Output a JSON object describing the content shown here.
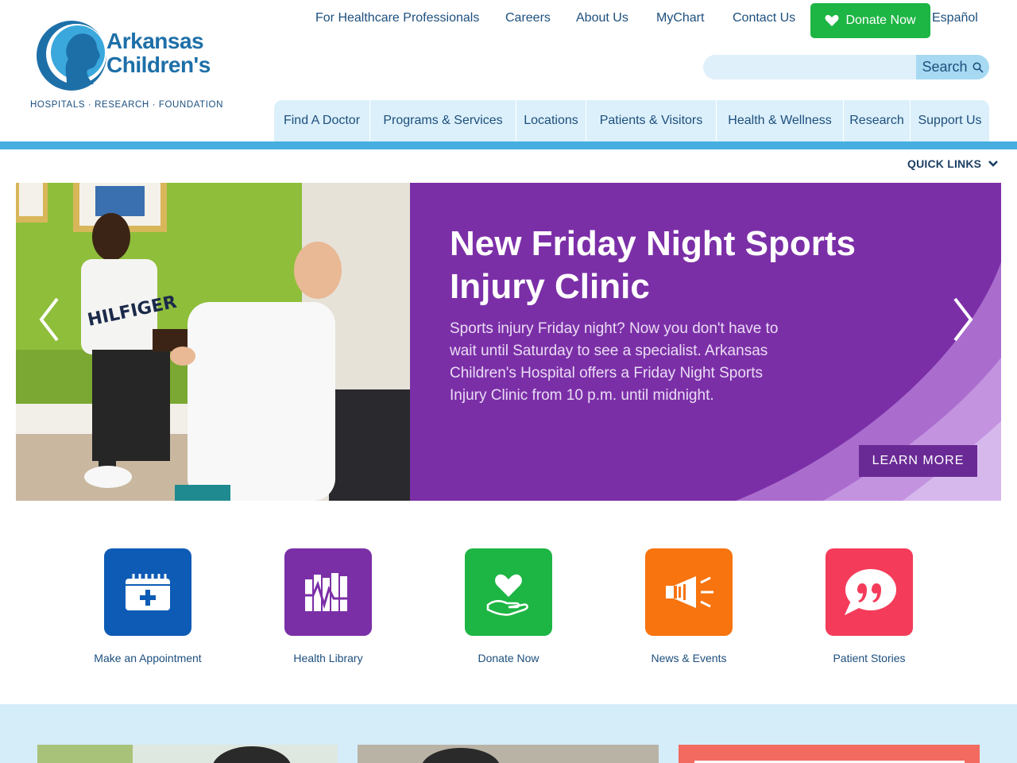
{
  "logo": {
    "line1": "Arkansas",
    "line2": "Children's",
    "tagline": "HOSPITALS · RESEARCH · FOUNDATION"
  },
  "utility_nav": [
    {
      "label": "For Healthcare Professionals"
    },
    {
      "label": "Careers"
    },
    {
      "label": "About Us"
    },
    {
      "label": "MyChart"
    },
    {
      "label": "Contact Us"
    },
    {
      "label": "Español"
    }
  ],
  "donate": {
    "label": "Donate Now"
  },
  "search": {
    "placeholder": "",
    "button_label": "Search"
  },
  "main_nav": [
    {
      "label": "Find A Doctor"
    },
    {
      "label": "Programs & Services"
    },
    {
      "label": "Locations"
    },
    {
      "label": "Patients & Visitors"
    },
    {
      "label": "Health & Wellness"
    },
    {
      "label": "Research"
    },
    {
      "label": "Support Us"
    }
  ],
  "quick_links": {
    "label": "QUICK LINKS"
  },
  "hero": {
    "title": "New Friday Night Sports Injury Clinic",
    "body": "Sports injury Friday night? Now you don't have to wait until Saturday to see a specialist. Arkansas Children's Hospital offers a Friday Night Sports Injury Clinic from 10 p.m. until midnight.",
    "cta": "LEARN MORE",
    "shirt_text": "HILFIGER"
  },
  "tiles": [
    {
      "label": "Make an Appointment",
      "icon": "calendar-plus-icon",
      "color": "#0d5bb5"
    },
    {
      "label": "Health Library",
      "icon": "books-icon",
      "color": "#7b2fa7"
    },
    {
      "label": "Donate Now",
      "icon": "heart-hand-icon",
      "color": "#1db544"
    },
    {
      "label": "News & Events",
      "icon": "megaphone-icon",
      "color": "#f7740f"
    },
    {
      "label": "Patient Stories",
      "icon": "quote-bubble-icon",
      "color": "#f43c5a"
    }
  ],
  "colors": {
    "brand_blue": "#1d6fa8",
    "nav_bar": "#46afe0",
    "hero_purple": "#7b2fa7",
    "donate_green": "#1db544"
  }
}
